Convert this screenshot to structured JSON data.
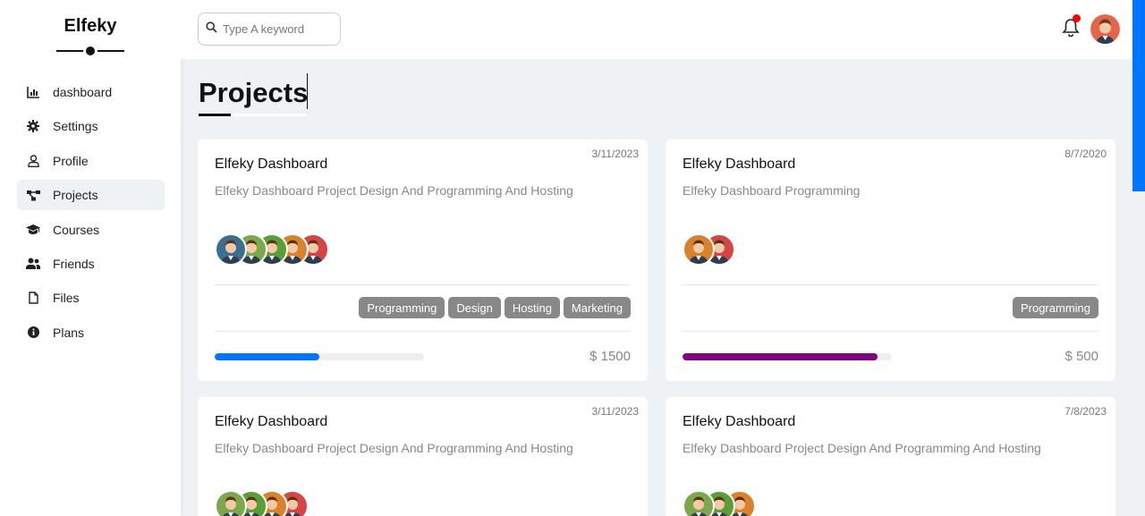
{
  "sidebar": {
    "logo": "Elfeky",
    "items": [
      {
        "label": "dashboard",
        "icon": "chart-icon",
        "active": false
      },
      {
        "label": "Settings",
        "icon": "gear-icon",
        "active": false
      },
      {
        "label": "Profile",
        "icon": "user-icon",
        "active": false
      },
      {
        "label": "Projects",
        "icon": "diagram-icon",
        "active": true
      },
      {
        "label": "Courses",
        "icon": "graduation-cap-icon",
        "active": false
      },
      {
        "label": "Friends",
        "icon": "users-icon",
        "active": false
      },
      {
        "label": "Files",
        "icon": "file-icon",
        "active": false
      },
      {
        "label": "Plans",
        "icon": "info-icon",
        "active": false
      }
    ]
  },
  "header": {
    "search_placeholder": "Type A keyword",
    "notification_dot_color": "#ff0000"
  },
  "page": {
    "title": "Projects"
  },
  "projects": [
    {
      "date": "3/11/2023",
      "title": "Elfeky Dashboard",
      "description": "Elfeky Dashboard Project Design And Programming And Hosting",
      "members": [
        "#3c6e8f",
        "#7aa84a",
        "#5a9e3a",
        "#d9822b",
        "#d64545"
      ],
      "tags": [
        "Programming",
        "Design",
        "Hosting",
        "Marketing"
      ],
      "progress": 0.5,
      "progress_color": "#0075ff",
      "price": "$ 1500"
    },
    {
      "date": "8/7/2020",
      "title": "Elfeky Dashboard",
      "description": "Elfeky Dashboard Programming",
      "members": [
        "#d9822b",
        "#d64545"
      ],
      "tags": [
        "Programming"
      ],
      "progress": 0.93,
      "progress_color": "#800080",
      "price": "$ 500"
    },
    {
      "date": "3/11/2023",
      "title": "Elfeky Dashboard",
      "description": "Elfeky Dashboard Project Design And Programming And Hosting",
      "members": [
        "#7aa84a",
        "#5a9e3a",
        "#d9822b",
        "#d64545"
      ],
      "tags": [],
      "progress": null,
      "progress_color": "",
      "price": ""
    },
    {
      "date": "7/8/2023",
      "title": "Elfeky Dashboard",
      "description": "Elfeky Dashboard Project Design And Programming And Hosting",
      "members": [
        "#7aa84a",
        "#5a9e3a",
        "#d9822b"
      ],
      "tags": [],
      "progress": null,
      "progress_color": "",
      "price": ""
    }
  ]
}
